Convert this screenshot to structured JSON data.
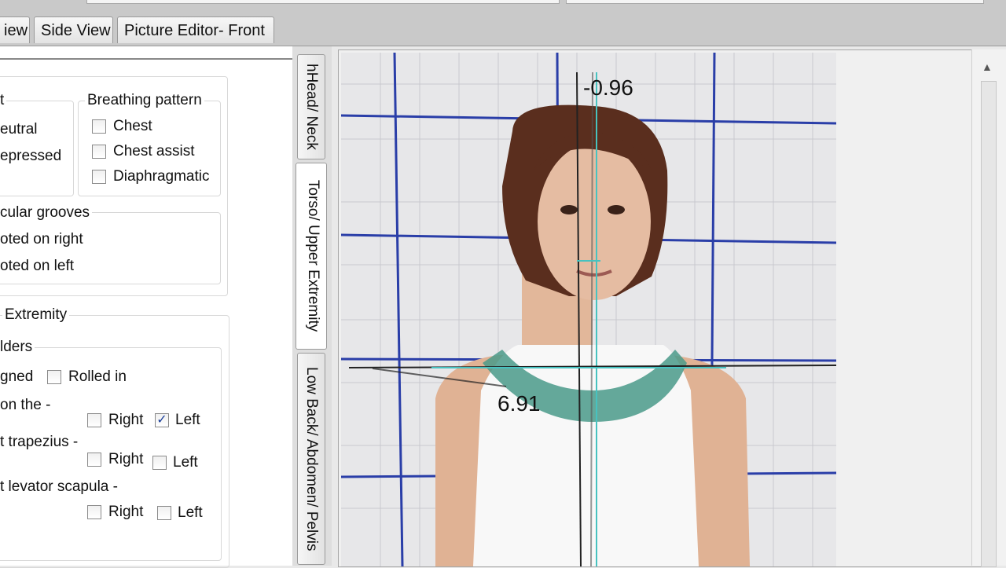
{
  "tabs": [
    {
      "label": "iew"
    },
    {
      "label": "Side View"
    },
    {
      "label": "Picture Editor- Front"
    }
  ],
  "form": {
    "chest_group": {
      "title": "t",
      "options": [
        "eutral",
        "epressed"
      ]
    },
    "breathing": {
      "title": "Breathing pattern",
      "options": [
        {
          "label": "Chest",
          "checked": false
        },
        {
          "label": "Chest assist",
          "checked": false
        },
        {
          "label": "Diaphragmatic",
          "checked": false
        }
      ]
    },
    "grooves": {
      "title": "cular grooves",
      "options": [
        "oted on right",
        "oted on left"
      ]
    },
    "upper_extremity": {
      "title": "Extremity",
      "shoulders_title": "lders",
      "aligned_label": "gned",
      "rolled_in": {
        "label": "Rolled in",
        "checked": false
      },
      "rows": [
        {
          "label": "on the -",
          "right": {
            "label": "Right",
            "checked": false
          },
          "left": {
            "label": "Left",
            "checked": true
          }
        },
        {
          "label": "t trapezius -",
          "right": {
            "label": "Right",
            "checked": false
          },
          "left": {
            "label": "Left",
            "checked": false
          }
        },
        {
          "label": "t levator scapula -",
          "right": {
            "label": "Right",
            "checked": false
          },
          "left": {
            "label": "Left",
            "checked": false
          }
        }
      ]
    }
  },
  "side_tabs": [
    {
      "label": "hHead/ Neck"
    },
    {
      "label": "Torso/ Upper Extremity"
    },
    {
      "label": "Low Back/ Abdomen/ Pelvis"
    }
  ],
  "readouts": {
    "top": "-0.96",
    "shoulder": "6.91"
  },
  "colors": {
    "grid": "#2a3ea8",
    "measure_line": "#47c2c0",
    "wall": "#e9e9ea"
  }
}
